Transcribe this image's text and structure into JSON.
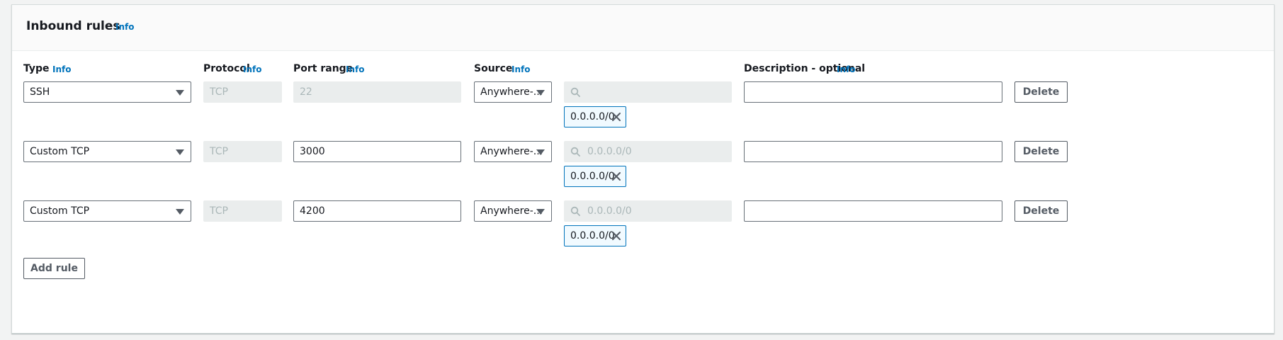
{
  "section": {
    "title": "Inbound rules",
    "info_label": "Info"
  },
  "columns": {
    "type": "Type",
    "protocol": "Protocol",
    "port_range": "Port range",
    "source": "Source",
    "description": "Description - optional",
    "info_label": "Info"
  },
  "rules": [
    {
      "type": "SSH",
      "protocol": "TCP",
      "port_range": "22",
      "port_editable": false,
      "source_type": "Anywhere-...",
      "source_search": "",
      "cidr": "0.0.0.0/0",
      "description": "",
      "delete_label": "Delete"
    },
    {
      "type": "Custom TCP",
      "protocol": "TCP",
      "port_range": "3000",
      "port_editable": true,
      "source_type": "Anywhere-...",
      "source_search": "0.0.0.0/0",
      "cidr": "0.0.0.0/0",
      "description": "",
      "delete_label": "Delete"
    },
    {
      "type": "Custom TCP",
      "protocol": "TCP",
      "port_range": "4200",
      "port_editable": true,
      "source_type": "Anywhere-...",
      "source_search": "0.0.0.0/0",
      "cidr": "0.0.0.0/0",
      "description": "",
      "delete_label": "Delete"
    }
  ],
  "add_rule_label": "Add rule",
  "colors": {
    "link": "#0073bb",
    "token_border": "#0073bb",
    "token_bg": "#f1faff",
    "disabled_bg": "#eaeded"
  }
}
